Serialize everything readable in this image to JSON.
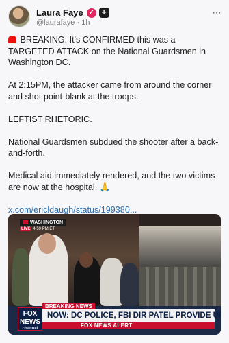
{
  "post": {
    "author_name": "Laura Faye",
    "handle": "@laurafaye",
    "separator": "·",
    "time": "1h",
    "more_label": "···",
    "paragraphs": [
      "BREAKING: It's CONFIRMED this was a TARGETED ATTACK on the National Guardsmen in Washington DC.",
      "At 2:15PM, the attacker came from around the corner and shot point-blank at the troops.",
      "LEFTIST RHETORIC.",
      "National Guardsmen subdued the shooter after a back-and-forth.",
      "Medical aid immediately rendered, and the two victims are now at the hospital. 🙏"
    ],
    "link": "x.com/ericldaugh/status/199380..."
  },
  "media": {
    "location_tag": "WASHINGTON",
    "live_label": "LIVE",
    "live_time": "4:59 PM ET",
    "breaking_label": "BREAKING NEWS",
    "headline": "NOW: DC POLICE, FBI DIR PATEL PROVIDE UPDATE",
    "network_alert": "FOX NEWS ALERT",
    "logo_line1": "FOX",
    "logo_line2": "NEWS",
    "logo_line3": "channel"
  },
  "colors": {
    "brand_red": "#c8102e",
    "navy": "#0b1e44",
    "link_blue": "#2a6fb0"
  }
}
